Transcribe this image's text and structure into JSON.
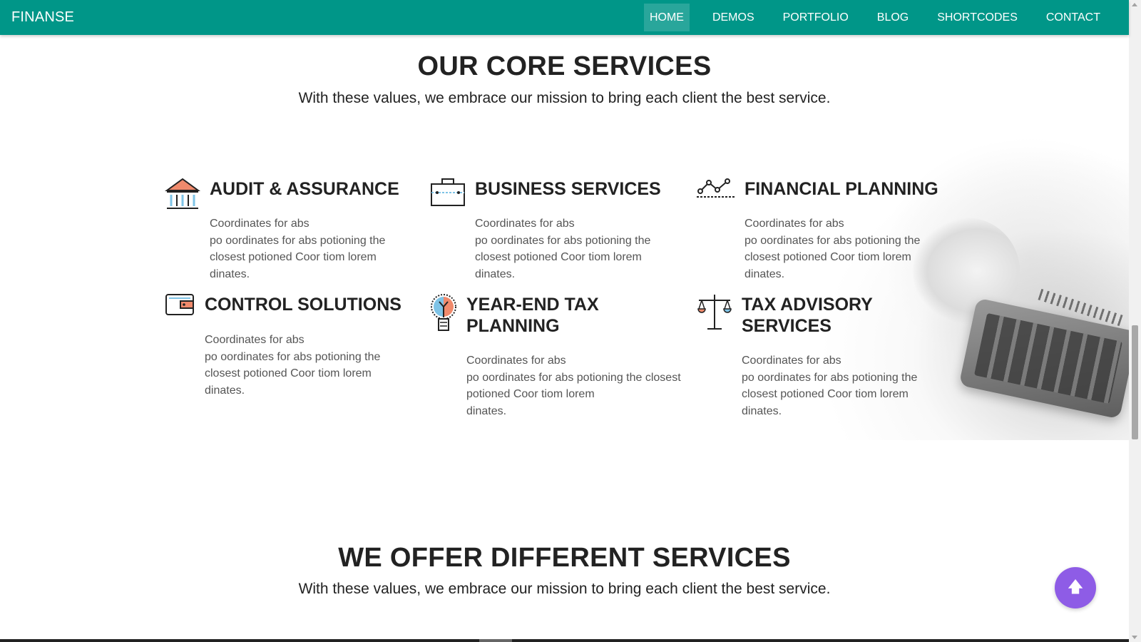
{
  "navbar": {
    "brand": "FINANSE",
    "items": [
      {
        "label": "HOME",
        "active": true
      },
      {
        "label": "DEMOS"
      },
      {
        "label": "PORTFOLIO"
      },
      {
        "label": "BLOG"
      },
      {
        "label": "SHORTCODES"
      },
      {
        "label": "CONTACT"
      }
    ]
  },
  "core": {
    "title": "OUR CORE SERVICES",
    "subtitle": "With these values, we embrace our mission to bring each client the best service."
  },
  "services": [
    {
      "title_lines": [
        "AUDIT & ASSURANCE"
      ],
      "icon": "bank-icon",
      "desc_lines": [
        "Coordinates for abs",
        "po oordinates for abs potioning the",
        "closest potioned Coor tiom lorem",
        "dinates."
      ]
    },
    {
      "title_lines": [
        "BUSINESS SERVICES"
      ],
      "icon": "briefcase-icon",
      "desc_lines": [
        "Coordinates for abs",
        "po oordinates for abs potioning the",
        "closest potioned Coor tiom lorem",
        "dinates."
      ]
    },
    {
      "title_lines": [
        "FINANCIAL PLANNING"
      ],
      "icon": "line-chart-icon",
      "desc_lines": [
        "Coordinates for abs",
        "po oordinates for abs potioning the",
        "closest potioned Coor tiom lorem",
        "dinates."
      ]
    },
    {
      "title_lines": [
        "CONTROL SOLUTIONS"
      ],
      "icon": "wallet-icon",
      "desc_lines": [
        "Coordinates for abs",
        "po oordinates for abs potioning the",
        "closest potioned Coor tiom lorem",
        "dinates."
      ]
    },
    {
      "title_lines": [
        "YEAR-END TAX",
        "PLANNING"
      ],
      "icon": "lightbulb-icon",
      "desc_lines": [
        "Coordinates for abs",
        "po oordinates for abs potioning the closest",
        "potioned Coor tiom lorem",
        "dinates."
      ]
    },
    {
      "title_lines": [
        "TAX ADVISORY",
        "SERVICES"
      ],
      "icon": "scales-icon",
      "desc_lines": [
        "Coordinates for abs",
        "po oordinates for abs potioning the",
        "closest potioned Coor tiom lorem",
        "dinates."
      ]
    }
  ],
  "offer": {
    "title": "WE OFFER DIFFERENT SERVICES",
    "subtitle": "With these values, we embrace our mission to bring each client the best service."
  },
  "back_to_top": {
    "icon": "arrow-up-icon"
  },
  "colors": {
    "primary": "#009688",
    "accent": "#8e5ce6",
    "icon_orange": "#f08a6c",
    "icon_blue": "#7ec3e6"
  }
}
